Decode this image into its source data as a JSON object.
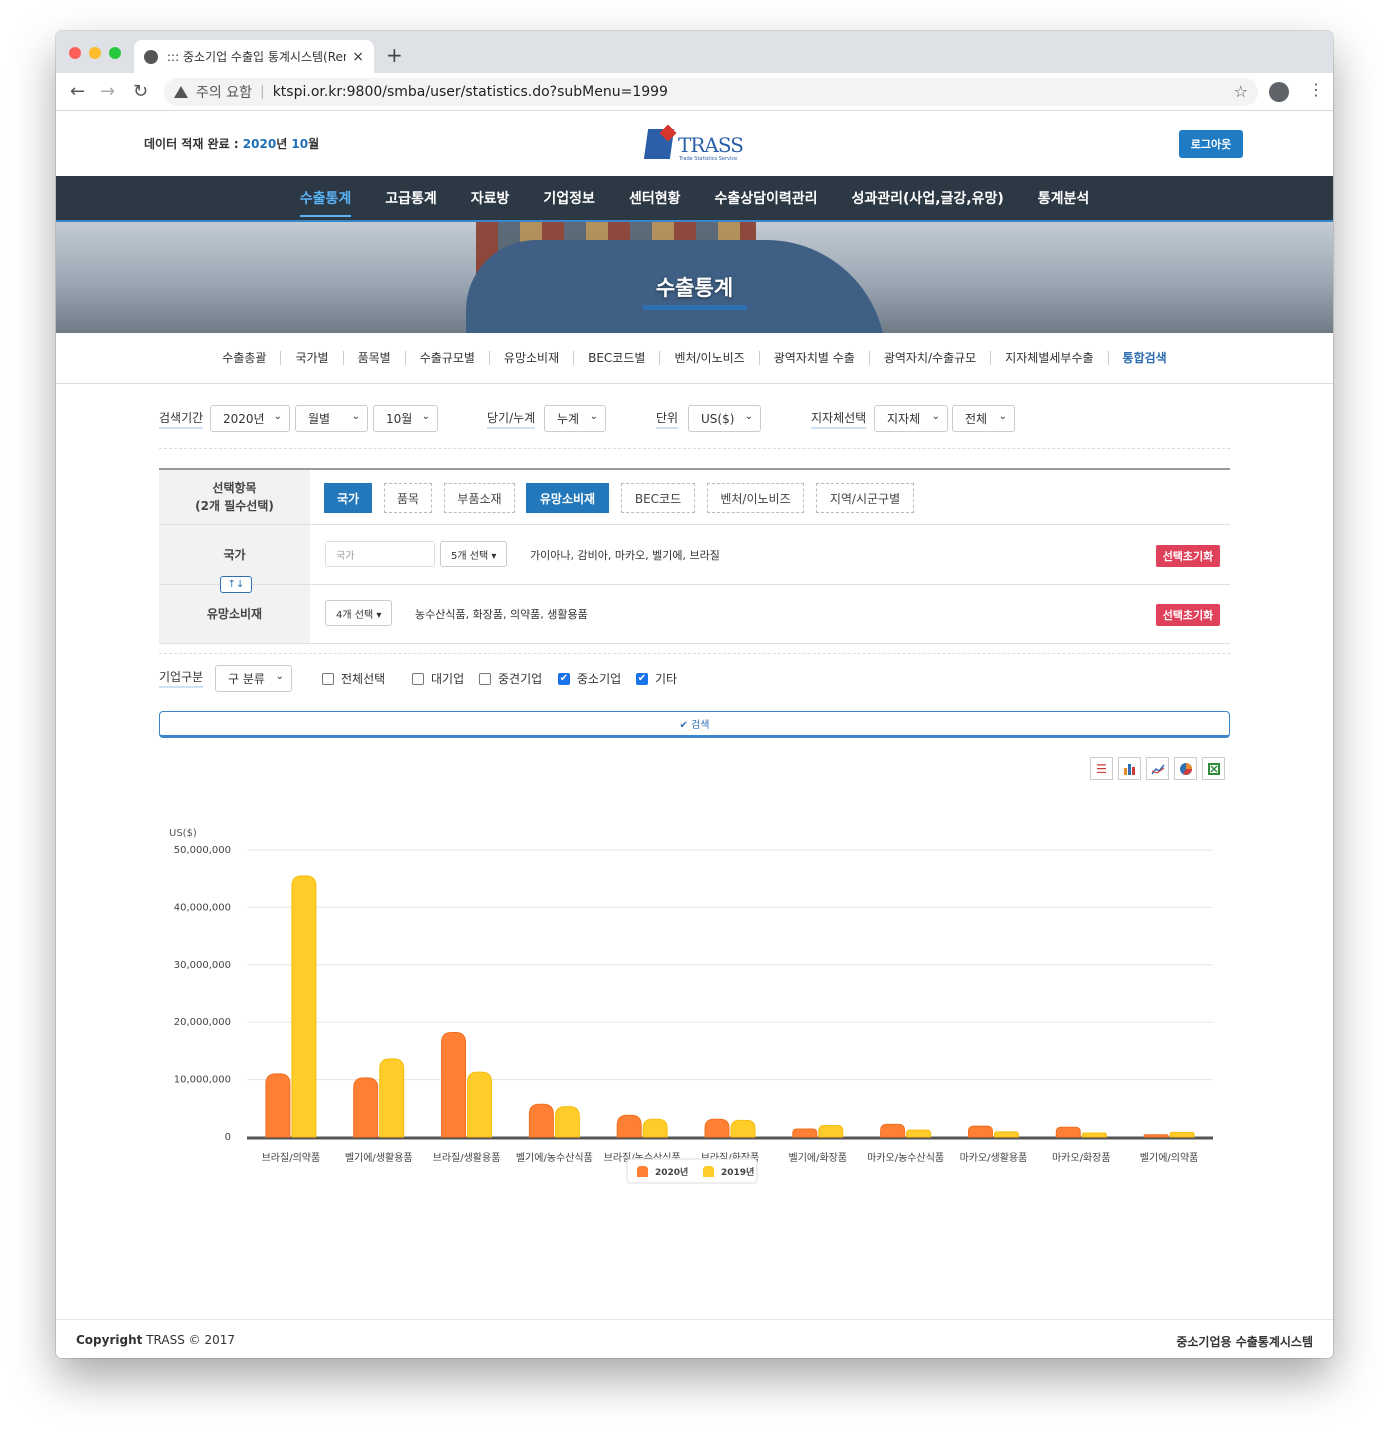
{
  "browser": {
    "tab_title": "::: 중소기업 수출입 통계시스템(Ren",
    "close_glyph": "×",
    "newtab_glyph": "+",
    "warning_label": "주의 요함",
    "url": "ktspi.or.kr:9800/smba/user/statistics.do?subMenu=1999"
  },
  "header": {
    "data_status_prefix": "데이터 적재 완료 : ",
    "data_year": "2020",
    "year_suffix": "년 ",
    "data_month": "10",
    "month_suffix": "월",
    "logo_text": "TRASS",
    "logo_sub": "Trade Statistics Service",
    "logout_label": "로그아웃"
  },
  "main_nav": [
    "수출통계",
    "고급통계",
    "자료방",
    "기업정보",
    "센터현황",
    "수출상담이력관리",
    "성과관리(사업,글강,유망)",
    "통계분석"
  ],
  "hero_title": "수출통계",
  "sub_nav": [
    "수출총괄",
    "국가별",
    "품목별",
    "수출규모별",
    "유망소비재",
    "BEC코드별",
    "벤처/이노비즈",
    "광역자치별 수출",
    "광역자치/수출규모",
    "지자체별세부수출",
    "통합검색"
  ],
  "filters": {
    "period_label": "검색기간",
    "year": "2020년",
    "period_type": "월별",
    "month": "10월",
    "cumul_label": "당기/누계",
    "cumul": "누계",
    "unit_label": "단위",
    "unit": "US($)",
    "region_label": "지자체선택",
    "region_type": "지자체",
    "region": "전체"
  },
  "selection": {
    "head_line1": "선택항목",
    "head_line2": "(2개 필수선택)",
    "chips": [
      "국가",
      "품목",
      "부품소재",
      "유망소비재",
      "BEC코드",
      "벤처/이노비즈",
      "지역/시군구별"
    ],
    "row1_label": "국가",
    "row1_placeholder": "국가",
    "row1_dropdown": "5개 선택 ▾",
    "row1_values": "가이아나, 감비아, 마카오, 벨기에, 브라질",
    "row2_label": "유망소비재",
    "row2_dropdown": "4개 선택 ▾",
    "row2_values": "농수산식품, 화장품, 의약품, 생활용품",
    "reset_label": "선택초기화",
    "swap_glyph": "↑↓"
  },
  "company": {
    "label": "기업구분",
    "select": "구 분류",
    "options": [
      {
        "label": "전체선택",
        "checked": false
      },
      {
        "label": "대기업",
        "checked": false
      },
      {
        "label": "중견기업",
        "checked": false
      },
      {
        "label": "중소기업",
        "checked": true
      },
      {
        "label": "기타",
        "checked": true
      }
    ]
  },
  "search_label": "✔ 검색",
  "view_icons": [
    "table-icon",
    "bar-chart-icon",
    "line-chart-icon",
    "pie-chart-icon",
    "excel-icon"
  ],
  "colors": {
    "series_2020": "#ff7f35",
    "series_2019": "#ffcc29",
    "accent": "#1e7bc4",
    "nav_bg": "#2d3845"
  },
  "chart_data": {
    "type": "bar",
    "ylabel": "US($)",
    "ylim": [
      0,
      50000000
    ],
    "yticks": [
      "0",
      "10,000,000",
      "20,000,000",
      "30,000,000",
      "40,000,000",
      "50,000,000"
    ],
    "categories": [
      "브라질/의약품",
      "벨기에/생활용품",
      "브라질/생활용품",
      "벨기에/농수산식품",
      "브라질/농수산식품",
      "브라질/화장품",
      "벨기에/화장품",
      "마카오/농수산식품",
      "마카오/생활용품",
      "마카오/화장품",
      "벨기에/의약품"
    ],
    "series": [
      {
        "name": "2020년",
        "values": [
          11000000,
          10300000,
          18200000,
          5700000,
          3800000,
          3100000,
          1400000,
          2200000,
          1900000,
          1700000,
          400000
        ]
      },
      {
        "name": "2019년",
        "values": [
          45500000,
          13600000,
          11300000,
          5300000,
          3100000,
          2900000,
          2000000,
          1200000,
          900000,
          700000,
          800000
        ]
      }
    ],
    "grid": true,
    "legend": "bottom-center"
  },
  "footer": {
    "copyright_prefix": "Copyright",
    "copyright_rest": " TRASS © 2017",
    "system_name": "중소기업용 수출통계시스템"
  }
}
